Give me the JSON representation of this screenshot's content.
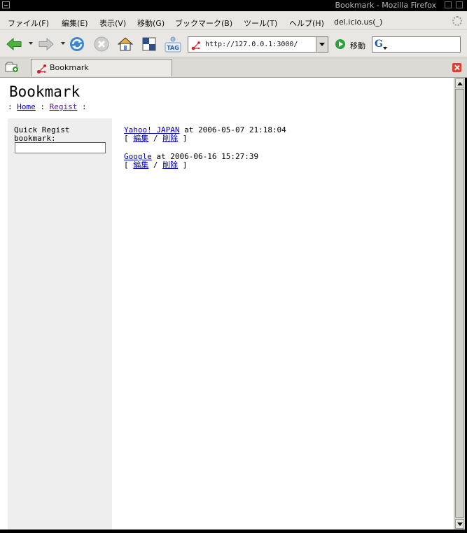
{
  "window": {
    "title": "Bookmark - Mozilla Firefox"
  },
  "menubar": {
    "items": [
      "ファイル(F)",
      "編集(E)",
      "表示(V)",
      "移動(G)",
      "ブックマーク(B)",
      "ツール(T)",
      "ヘルプ(H)",
      "del.icio.us(_)"
    ]
  },
  "navbar": {
    "url": "http://127.0.0.1:3000/",
    "go_label": "移動",
    "tag_label": "TAG",
    "search_engine_glyph": "G",
    "search_value": ""
  },
  "tabs": [
    {
      "label": "Bookmark"
    }
  ],
  "page": {
    "title": "Bookmark",
    "breadcrumb": {
      "sep": ":",
      "home": "Home",
      "regist": "Regist"
    },
    "sidebar": {
      "quick_label": "Quick Regist bookmark:",
      "quick_value": ""
    },
    "bookmarks": [
      {
        "name": "Yahoo! JAPAN",
        "meta": "at 2006-05-07 21:18:04",
        "edit": "編集",
        "delete": "削除"
      },
      {
        "name": "Google",
        "meta": "at 2006-06-16 15:27:39",
        "edit": "編集",
        "delete": "削除"
      }
    ],
    "action_open": "[",
    "action_sep": "/",
    "action_close": "]"
  },
  "colors": {
    "link": "#0000cc",
    "visited_link": "#551a8b",
    "sidebar_bg": "#eeeeee",
    "close_button": "#e03b2f"
  }
}
